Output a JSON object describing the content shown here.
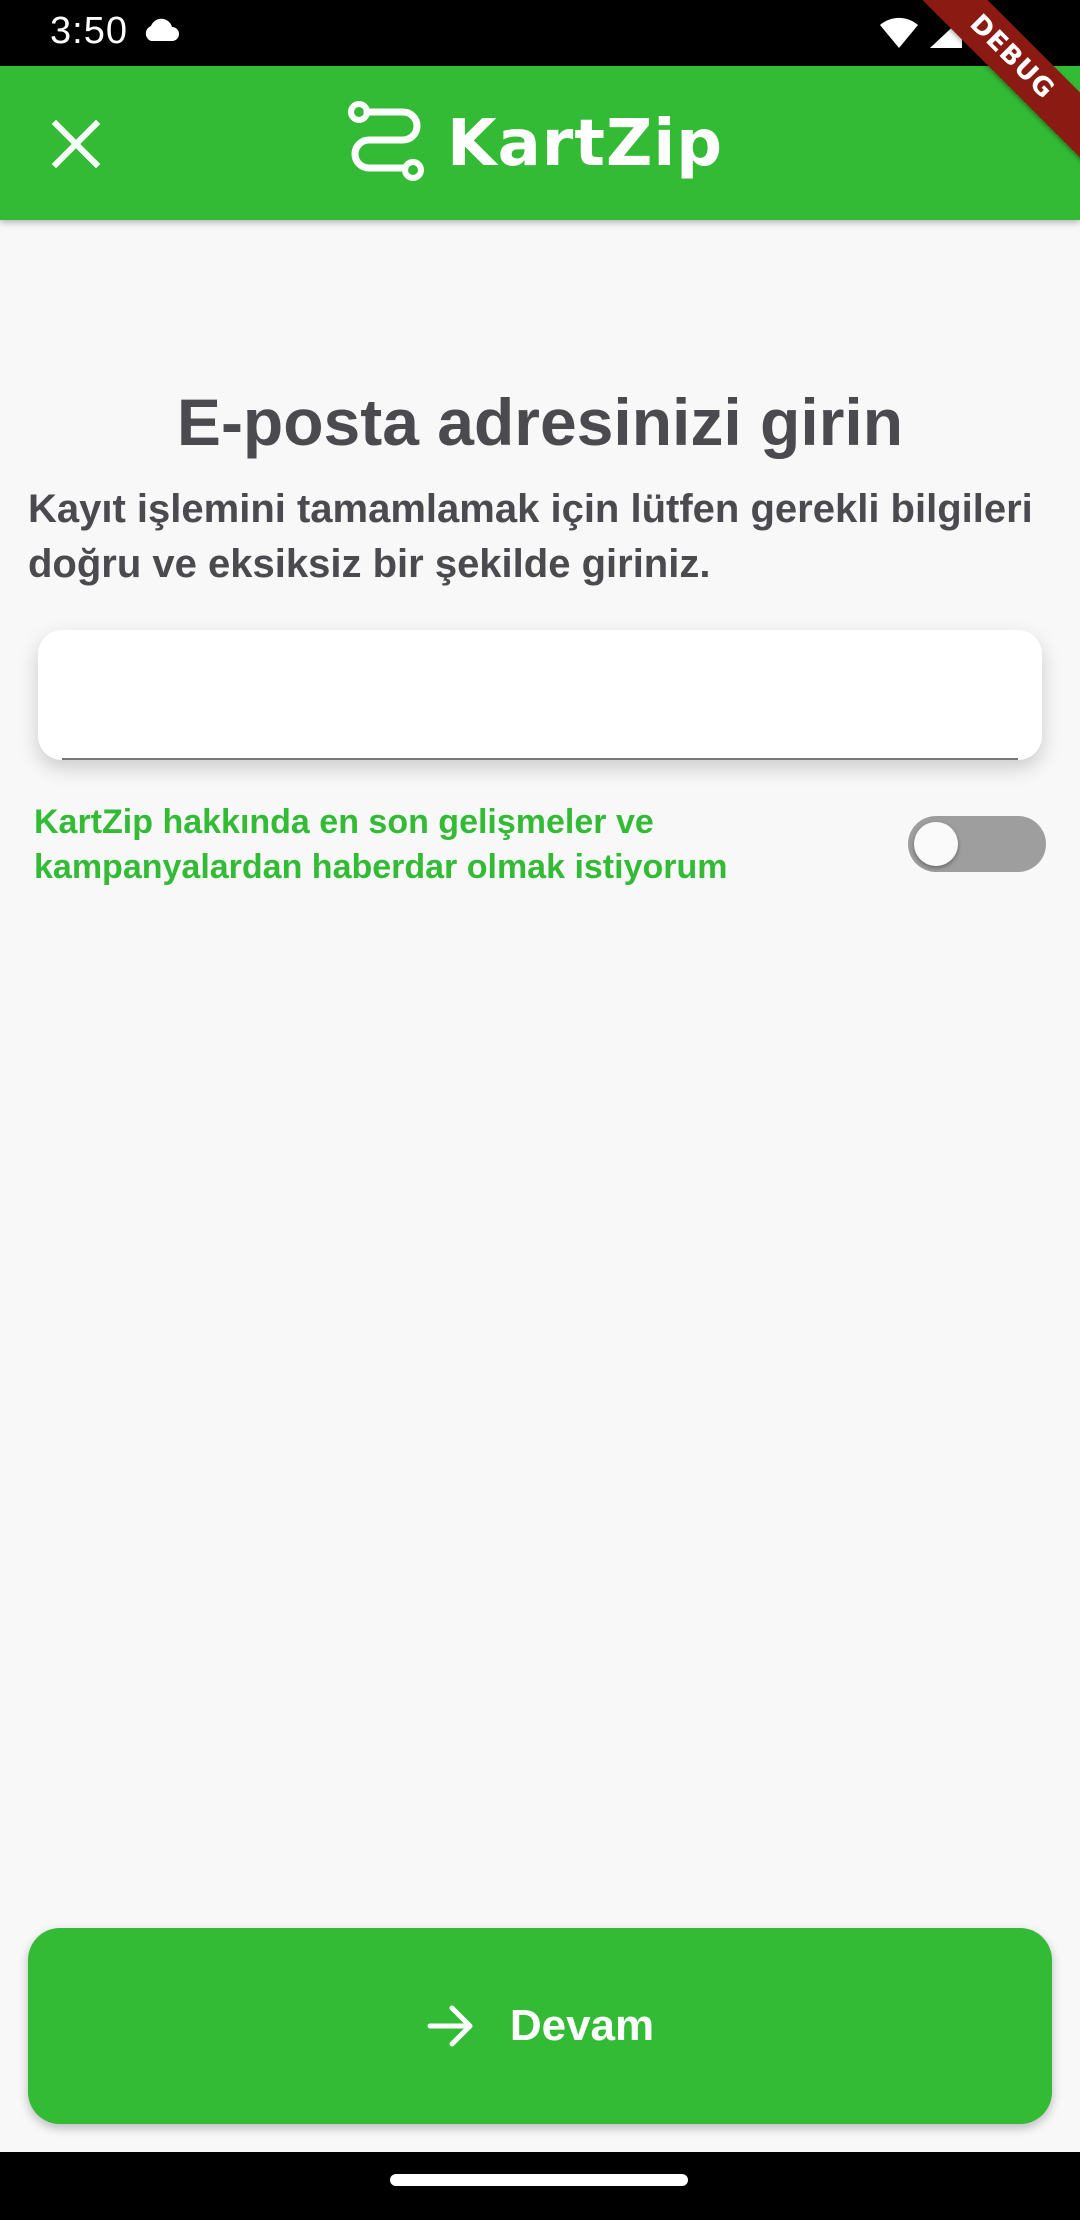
{
  "status_bar": {
    "time": "3:50",
    "icons": [
      "cloud-icon",
      "wifi-icon",
      "signal-icon",
      "battery-icon"
    ]
  },
  "app_bar": {
    "brand_name": "KartZip",
    "close_icon": "close-icon",
    "logo_icon": "route-logo-icon",
    "background": "#33bb36"
  },
  "debug_banner": "DEBUG",
  "main": {
    "title": "E-posta adresinizi girin",
    "subtitle": "Kayıt işlemini tamamlamak için lütfen gerekli bilgileri doğru ve eksiksiz bir şekilde giriniz.",
    "email_value": "",
    "consent_text": "KartZip hakkında en son gelişmeler ve kampanyalardan haberdar olmak istiyorum",
    "consent_toggle_on": false
  },
  "footer": {
    "continue_label": "Devam",
    "continue_icon": "arrow-right-icon"
  },
  "colors": {
    "accent": "#33bb36",
    "text_dark": "#4a4a4f",
    "background": "#f8f8f8"
  }
}
